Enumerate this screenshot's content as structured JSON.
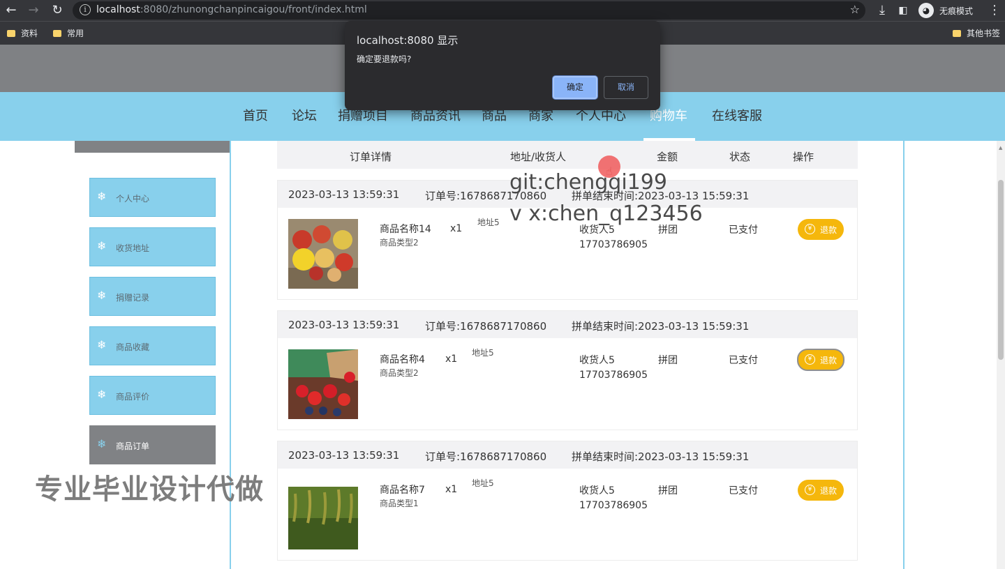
{
  "browser": {
    "url_host": "localhost",
    "url_rest": ":8080/zhunongchanpincaigou/front/index.html",
    "incognito_label": "无痕模式",
    "bookmarks": [
      "资料",
      "常用"
    ],
    "other_bookmarks": "其他书签"
  },
  "nav": {
    "items": [
      "首页",
      "论坛",
      "捐赠项目",
      "商品资讯",
      "商品",
      "商家",
      "个人中心",
      "购物车",
      "在线客服"
    ],
    "active": "购物车"
  },
  "sidebar": {
    "items": [
      "个人中心",
      "收货地址",
      "捐赠记录",
      "商品收藏",
      "商品评价",
      "商品订单"
    ],
    "active": "商品订单"
  },
  "table_header": {
    "detail": "订单详情",
    "address": "地址/收货人",
    "amount": "金额",
    "status": "状态",
    "action": "操作"
  },
  "orders": [
    {
      "time": "2023-03-13 13:59:31",
      "order_no": "订单号:1678687170860",
      "end_time": "拼单结束时间:2023-03-13 15:59:31",
      "product_name": "商品名称14",
      "product_type": "商品类型2",
      "qty": "x1",
      "address": "地址5",
      "receiver": "收货人5",
      "phone": "17703786905",
      "amount": "拼团",
      "status": "已支付",
      "refund": "退款",
      "image": "fruit-basket"
    },
    {
      "time": "2023-03-13 13:59:31",
      "order_no": "订单号:1678687170860",
      "end_time": "拼单结束时间:2023-03-13 15:59:31",
      "product_name": "商品名称4",
      "product_type": "商品类型2",
      "qty": "x1",
      "address": "地址5",
      "receiver": "收货人5",
      "phone": "17703786905",
      "amount": "拼团",
      "status": "已支付",
      "refund": "退款",
      "image": "berries"
    },
    {
      "time": "2023-03-13 13:59:31",
      "order_no": "订单号:1678687170860",
      "end_time": "拼单结束时间:2023-03-13 15:59:31",
      "product_name": "商品名称7",
      "product_type": "商品类型1",
      "qty": "x1",
      "address": "地址5",
      "receiver": "收货人5",
      "phone": "17703786905",
      "amount": "拼团",
      "status": "已支付",
      "refund": "退款",
      "image": "millet-field"
    }
  ],
  "watermarks": {
    "line1": "git:chengqi199",
    "line2": "v x:chen_q123456",
    "big": "专业毕业设计代做"
  },
  "dialog": {
    "title": "localhost:8080 显示",
    "message": "确定要退款吗?",
    "ok": "确定",
    "cancel": "取消"
  },
  "colors": {
    "nav_bg": "#88d0ec",
    "banner_bg": "#7f8184",
    "refund_btn": "#f5b70c",
    "dialog_bg": "#2b2b2e",
    "dialog_ok": "#8ab4f8"
  }
}
